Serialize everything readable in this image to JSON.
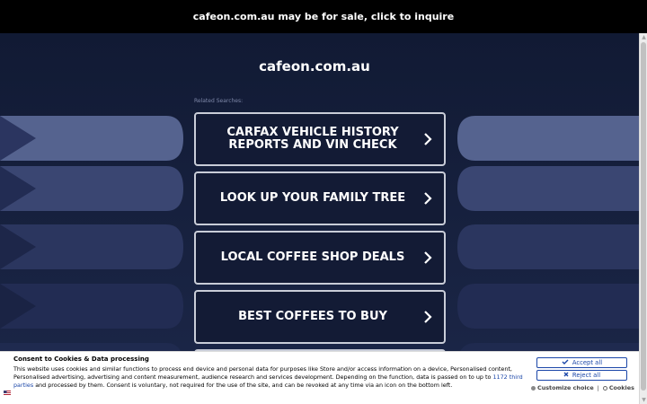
{
  "topbar": {
    "text": "cafeon.com.au may be for sale, click to inquire"
  },
  "domain": "cafeon.com.au",
  "related_label": "Related Searches:",
  "links": [
    {
      "line1": "CARFAX VEHICLE HISTORY",
      "line2": "REPORTS AND VIN CHECK"
    },
    {
      "line1": "LOOK UP YOUR FAMILY TREE",
      "line2": ""
    },
    {
      "line1": "LOCAL COFFEE SHOP DEALS",
      "line2": ""
    },
    {
      "line1": "BEST COFFEES TO BUY",
      "line2": ""
    }
  ],
  "consent": {
    "title": "Consent to Cookies & Data processing",
    "text_before_link": "This website uses cookies and similar functions to process end device and personal data for purposes like Store and/or access information on a device, Personalised content, Personalised advertising, advertising and content measurement, audience research and services development. Depending on the function, data is passed on to up to ",
    "link": "1172 third parties",
    "text_after_link": " and processed by them. Consent is voluntary, not required for the use of the site, and can be revoked at any time via an icon on the bottom left.",
    "accept_label": "Accept all",
    "reject_label": "Reject all",
    "customize_label": "Customize choice",
    "separator": "|",
    "cookies_label": "Cookies"
  },
  "colors": {
    "background": "#121a33",
    "button_border": "#c9cdd8",
    "consent_accent": "#1a46a8"
  }
}
